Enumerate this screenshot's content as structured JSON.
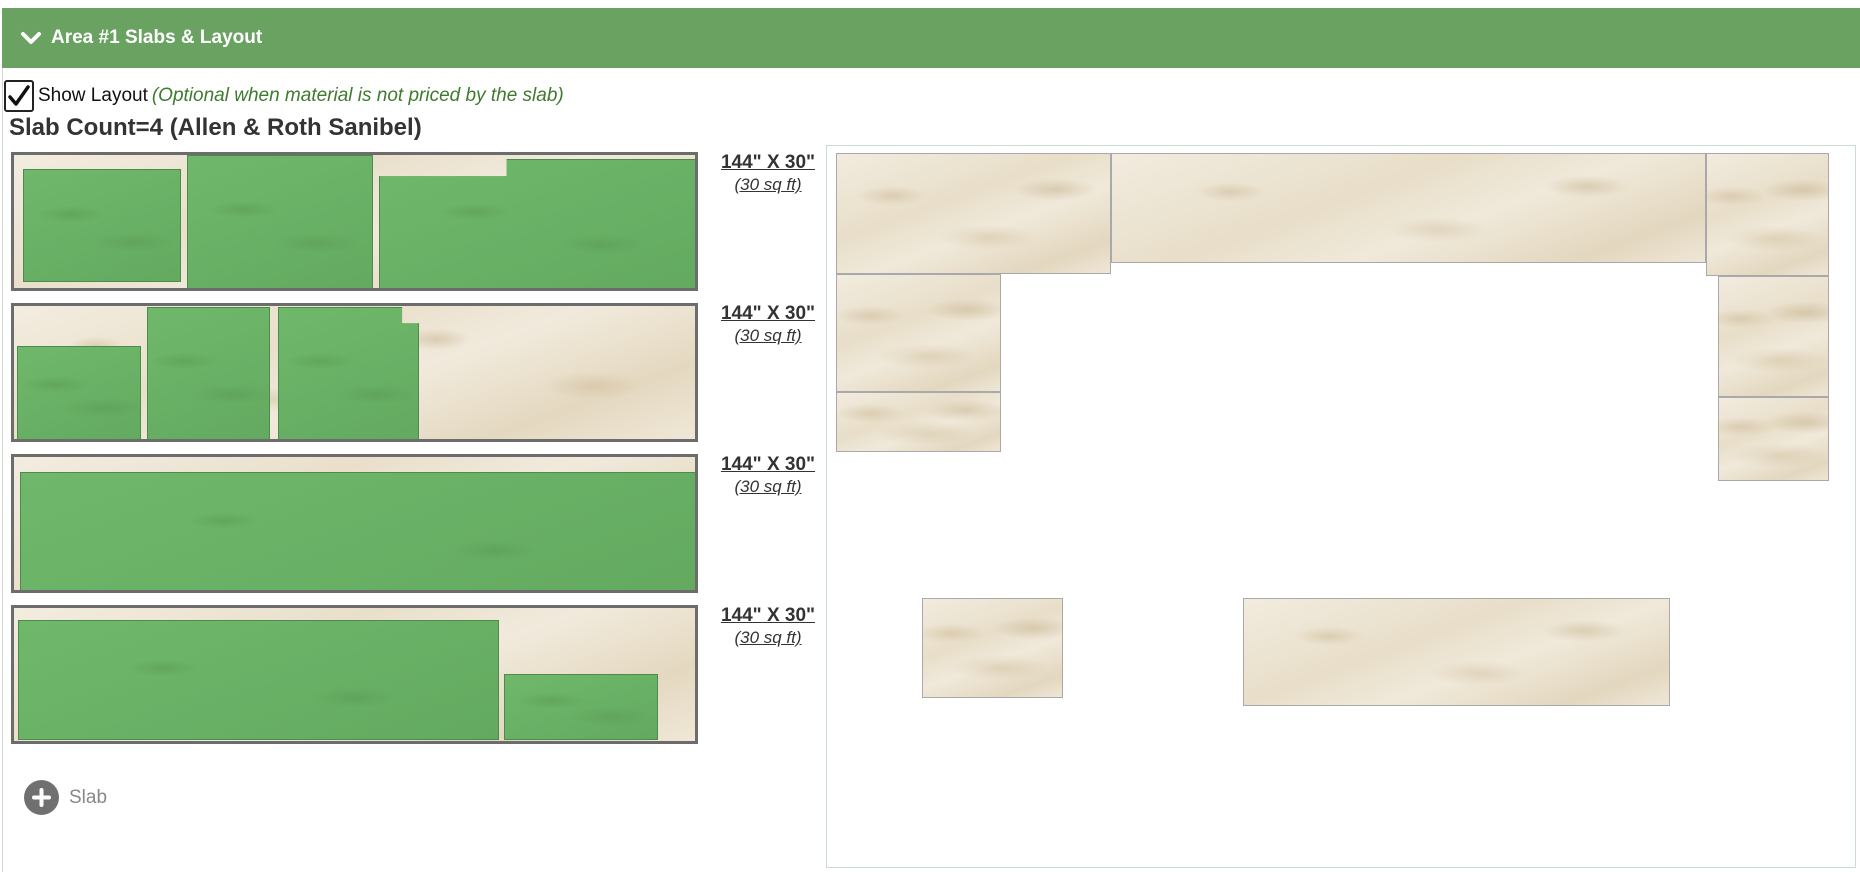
{
  "section": {
    "title": "Area #1 Slabs & Layout",
    "header_color": "#6aa262"
  },
  "layout_toggle": {
    "label": "Show Layout",
    "hint": "(Optional when material is not priced by the slab)",
    "checked": true
  },
  "slab_count_label": "Slab Count=4 (Allen & Roth Sanibel)",
  "slabs": [
    {
      "size": "144\" X 30\"",
      "area": "(30 sq ft)"
    },
    {
      "size": "144\" X 30\"",
      "area": "(30 sq ft)"
    },
    {
      "size": "144\" X 30\"",
      "area": "(30 sq ft)"
    },
    {
      "size": "144\" X 30\"",
      "area": "(30 sq ft)"
    }
  ],
  "add_slab": {
    "label": "Slab",
    "icon": "plus-circle-icon"
  },
  "colors": {
    "used_piece": "#6bb469",
    "hint_text": "#3f7a2f"
  }
}
